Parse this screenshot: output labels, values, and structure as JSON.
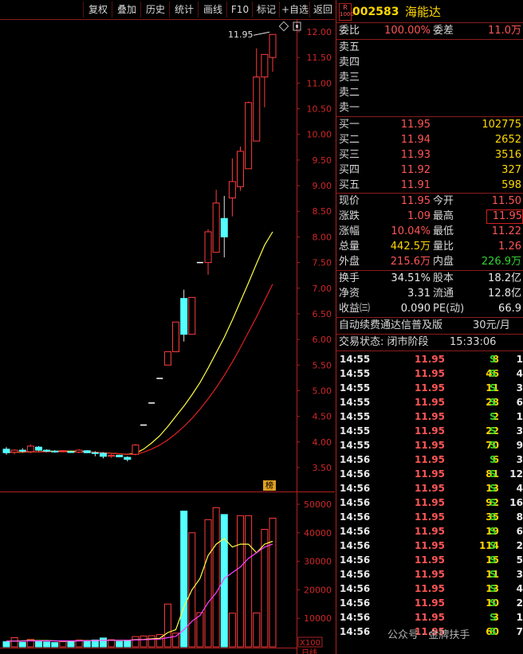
{
  "toolbar": {
    "buttons": [
      "复权",
      "叠加",
      "历史",
      "统计",
      "画线",
      "F10",
      "标记",
      "+自选",
      "返回"
    ]
  },
  "stock": {
    "badge_top": "R",
    "badge_bottom": "1000",
    "code": "002583",
    "name": "海能达"
  },
  "order_book": {
    "weibi_label": "委比",
    "weibi_value": "100.00%",
    "weicha_label": "委差",
    "weicha_value": "11.0万",
    "asks": [
      {
        "label": "卖五",
        "price": "",
        "volume": ""
      },
      {
        "label": "卖四",
        "price": "",
        "volume": ""
      },
      {
        "label": "卖三",
        "price": "",
        "volume": ""
      },
      {
        "label": "卖二",
        "price": "",
        "volume": ""
      },
      {
        "label": "卖一",
        "price": "",
        "volume": ""
      }
    ],
    "bids": [
      {
        "label": "买一",
        "price": "11.95",
        "volume": "102775"
      },
      {
        "label": "买二",
        "price": "11.94",
        "volume": "2652"
      },
      {
        "label": "买三",
        "price": "11.93",
        "volume": "3516"
      },
      {
        "label": "买四",
        "price": "11.92",
        "volume": "327"
      },
      {
        "label": "买五",
        "price": "11.91",
        "volume": "598"
      }
    ]
  },
  "quote": {
    "xianjia_label": "现价",
    "xianjia": "11.95",
    "jinkai_label": "今开",
    "jinkai": "11.50",
    "zhangdie_label": "涨跌",
    "zhangdie": "1.09",
    "zuigao_label": "最高",
    "zuigao": "11.95",
    "zhangfu_label": "涨幅",
    "zhangfu": "10.04%",
    "zuidi_label": "最低",
    "zuidi": "11.22",
    "zongliang_label": "总量",
    "zongliang": "442.5万",
    "liangbi_label": "量比",
    "liangbi": "1.26",
    "waipan_label": "外盘",
    "waipan": "215.6万",
    "neipan_label": "内盘",
    "neipan": "226.9万"
  },
  "fundamentals": {
    "huanshou_label": "换手",
    "huanshou": "34.51%",
    "guben_label": "股本",
    "guben": "18.2亿",
    "jingzi_label": "净资",
    "jingzi": "3.31",
    "liutong_label": "流通",
    "liutong": "12.8亿",
    "shouyi_label": "收益㈢",
    "shouyi": "0.090",
    "pe_label": "PE(动)",
    "pe": "66.9"
  },
  "promo": {
    "text": "自动续费通达信普及版",
    "price": "30元/月"
  },
  "status": {
    "label": "交易状态: 闭市阶段",
    "time": "15:33:06"
  },
  "ticks": [
    {
      "time": "14:55",
      "price": "11.95",
      "qty": "8",
      "side": "S",
      "num": "1"
    },
    {
      "time": "14:55",
      "price": "11.95",
      "qty": "46",
      "side": "S",
      "num": "4"
    },
    {
      "time": "14:55",
      "price": "11.95",
      "qty": "11",
      "side": "S",
      "num": "3"
    },
    {
      "time": "14:55",
      "price": "11.95",
      "qty": "28",
      "side": "S",
      "num": "6"
    },
    {
      "time": "14:55",
      "price": "11.95",
      "qty": "2",
      "side": "S",
      "num": "1"
    },
    {
      "time": "14:55",
      "price": "11.95",
      "qty": "22",
      "side": "S",
      "num": "3"
    },
    {
      "time": "14:55",
      "price": "11.95",
      "qty": "70",
      "side": "S",
      "num": "9"
    },
    {
      "time": "14:56",
      "price": "11.95",
      "qty": "6",
      "side": "S",
      "num": "3"
    },
    {
      "time": "14:56",
      "price": "11.95",
      "qty": "81",
      "side": "S",
      "num": "12"
    },
    {
      "time": "14:56",
      "price": "11.95",
      "qty": "13",
      "side": "S",
      "num": "4"
    },
    {
      "time": "14:56",
      "price": "11.95",
      "qty": "92",
      "side": "S",
      "num": "16"
    },
    {
      "time": "14:56",
      "price": "11.95",
      "qty": "35",
      "side": "S",
      "num": "8"
    },
    {
      "time": "14:56",
      "price": "11.95",
      "qty": "19",
      "side": "S",
      "num": "6"
    },
    {
      "time": "14:56",
      "price": "11.95",
      "qty": "114",
      "side": "S",
      "num": "2"
    },
    {
      "time": "14:56",
      "price": "11.95",
      "qty": "15",
      "side": "S",
      "num": "5"
    },
    {
      "time": "14:56",
      "price": "11.95",
      "qty": "11",
      "side": "S",
      "num": "3"
    },
    {
      "time": "14:56",
      "price": "11.95",
      "qty": "13",
      "side": "S",
      "num": "4"
    },
    {
      "time": "14:56",
      "price": "11.95",
      "qty": "10",
      "side": "S",
      "num": "2"
    },
    {
      "time": "14:56",
      "price": "11.95",
      "qty": "3",
      "side": "S",
      "num": "1"
    },
    {
      "time": "14:56",
      "price": "11.95",
      "qty": "60",
      "side": "S",
      "num": "7"
    }
  ],
  "watermark": "公众号 · 金牌扶手",
  "chart_data": {
    "type": "candlestick",
    "price_ticks": [
      "12.00",
      "11.50",
      "11.00",
      "10.50",
      "10.00",
      "9.50",
      "9.00",
      "8.50",
      "8.00",
      "7.50",
      "7.00",
      "6.50",
      "6.00",
      "5.50",
      "5.00",
      "4.50",
      "4.00",
      "3.50"
    ],
    "volume_ticks": [
      "50000",
      "40000",
      "30000",
      "20000",
      "10000"
    ],
    "volume_unit": "X100",
    "high_marker": "11.95",
    "bang_label": "榜",
    "bottom_label": "日线",
    "candles": [
      {
        "o": 3.86,
        "h": 3.9,
        "l": 3.75,
        "c": 3.79
      },
      {
        "o": 3.8,
        "h": 3.86,
        "l": 3.76,
        "c": 3.84
      },
      {
        "o": 3.84,
        "h": 3.88,
        "l": 3.8,
        "c": 3.82
      },
      {
        "o": 3.81,
        "h": 3.95,
        "l": 3.78,
        "c": 3.92
      },
      {
        "o": 3.9,
        "h": 3.92,
        "l": 3.82,
        "c": 3.84
      },
      {
        "o": 3.84,
        "h": 3.86,
        "l": 3.8,
        "c": 3.82
      },
      {
        "o": 3.82,
        "h": 3.84,
        "l": 3.79,
        "c": 3.81
      },
      {
        "o": 3.82,
        "h": 3.84,
        "l": 3.8,
        "c": 3.83
      },
      {
        "o": 3.81,
        "h": 3.83,
        "l": 3.79,
        "c": 3.8
      },
      {
        "o": 3.8,
        "h": 3.86,
        "l": 3.78,
        "c": 3.84
      },
      {
        "o": 3.83,
        "h": 3.84,
        "l": 3.78,
        "c": 3.79
      },
      {
        "o": 3.79,
        "h": 3.82,
        "l": 3.72,
        "c": 3.78
      },
      {
        "o": 3.78,
        "h": 3.8,
        "l": 3.68,
        "c": 3.72
      },
      {
        "o": 3.72,
        "h": 3.76,
        "l": 3.69,
        "c": 3.74
      },
      {
        "o": 3.74,
        "h": 3.75,
        "l": 3.7,
        "c": 3.71
      },
      {
        "o": 3.7,
        "h": 3.72,
        "l": 3.62,
        "c": 3.66
      },
      {
        "o": 3.76,
        "h": 3.96,
        "l": 3.74,
        "c": 3.94
      },
      {
        "o": 4.33,
        "h": 4.33,
        "l": 4.33,
        "c": 4.33
      },
      {
        "o": 4.76,
        "h": 4.76,
        "l": 4.76,
        "c": 4.76
      },
      {
        "o": 5.24,
        "h": 5.24,
        "l": 5.24,
        "c": 5.24
      },
      {
        "o": 5.5,
        "h": 5.76,
        "l": 5.5,
        "c": 5.76
      },
      {
        "o": 5.76,
        "h": 6.34,
        "l": 5.76,
        "c": 6.34
      },
      {
        "o": 6.8,
        "h": 6.97,
        "l": 5.96,
        "c": 6.1
      },
      {
        "o": 6.1,
        "h": 6.82,
        "l": 6.1,
        "c": 6.82
      },
      {
        "o": 7.5,
        "h": 7.5,
        "l": 7.5,
        "c": 7.5
      },
      {
        "o": 7.5,
        "h": 8.15,
        "l": 7.26,
        "c": 8.1
      },
      {
        "o": 7.7,
        "h": 8.92,
        "l": 7.7,
        "c": 8.66
      },
      {
        "o": 8.36,
        "h": 8.8,
        "l": 7.6,
        "c": 8.0
      },
      {
        "o": 8.76,
        "h": 9.53,
        "l": 8.4,
        "c": 9.08
      },
      {
        "o": 8.98,
        "h": 9.76,
        "l": 8.9,
        "c": 9.67
      },
      {
        "o": 9.33,
        "h": 10.64,
        "l": 9.33,
        "c": 10.62
      },
      {
        "o": 9.87,
        "h": 11.68,
        "l": 9.87,
        "c": 11.12
      },
      {
        "o": 11.12,
        "h": 11.32,
        "l": 10.53,
        "c": 11.56
      },
      {
        "o": 11.5,
        "h": 11.95,
        "l": 11.22,
        "c": 11.95
      }
    ],
    "volumes": [
      1800,
      3200,
      1600,
      2600,
      2000,
      1700,
      1500,
      1800,
      2100,
      2400,
      2200,
      2400,
      3100,
      2500,
      1900,
      2200,
      3600,
      3800,
      3900,
      4300,
      15000,
      4800,
      47600,
      40000,
      12000,
      44600,
      48800,
      46400,
      11800,
      46000,
      46000,
      11900,
      41200,
      45100
    ],
    "ma_price_a": [
      3.8,
      3.8,
      3.8,
      3.81,
      3.81,
      3.82,
      3.82,
      3.82,
      3.82,
      3.82,
      3.81,
      3.8,
      3.79,
      3.78,
      3.77,
      3.76,
      3.78,
      3.86,
      3.98,
      4.12,
      4.3,
      4.5,
      4.7,
      4.92,
      5.16,
      5.44,
      5.74,
      6.04,
      6.38,
      6.74,
      7.1,
      7.48,
      7.84,
      8.1
    ],
    "ma_price_b": [
      3.8,
      3.8,
      3.81,
      3.81,
      3.81,
      3.81,
      3.81,
      3.81,
      3.81,
      3.81,
      3.8,
      3.8,
      3.79,
      3.78,
      3.77,
      3.76,
      3.76,
      3.8,
      3.86,
      3.94,
      4.04,
      4.16,
      4.3,
      4.46,
      4.64,
      4.84,
      5.06,
      5.3,
      5.56,
      5.84,
      6.14,
      6.44,
      6.76,
      7.08
    ],
    "ma_vol_a": [
      2000,
      2000,
      2100,
      2200,
      2200,
      2200,
      2100,
      2000,
      2000,
      2100,
      2200,
      2200,
      2300,
      2300,
      2300,
      2300,
      2500,
      2600,
      2800,
      3000,
      5000,
      6000,
      14000,
      20000,
      24000,
      32000,
      36000,
      38000,
      35000,
      36000,
      36000,
      33000,
      36000,
      37000
    ],
    "ma_vol_b": [
      2000,
      2000,
      2050,
      2100,
      2100,
      2100,
      2100,
      2100,
      2100,
      2100,
      2150,
      2200,
      2250,
      2300,
      2300,
      2300,
      2400,
      2500,
      2600,
      2700,
      3200,
      3700,
      6000,
      9000,
      11000,
      15500,
      19000,
      24000,
      26000,
      28000,
      31000,
      33000,
      35000,
      36000
    ]
  }
}
